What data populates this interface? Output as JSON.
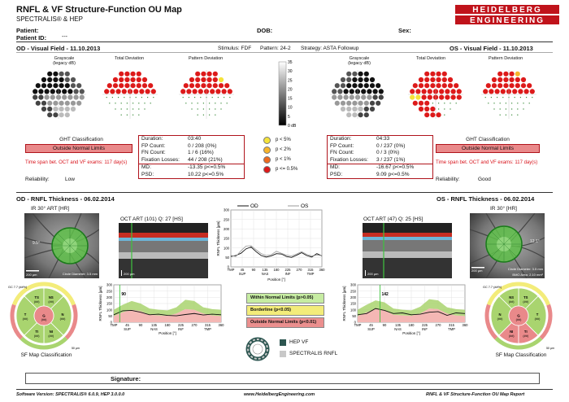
{
  "header": {
    "title": "RNFL & VF Structure-Function OU Map",
    "subtitle": "SPECTRALIS® & HEP",
    "logo_line1": "HEIDELBERG",
    "logo_line2": "ENGINEERING",
    "patient_label": "Patient:",
    "patient_id_label": "Patient ID:",
    "patient_id_value": "---",
    "dob_label": "DOB:",
    "sex_label": "Sex:"
  },
  "vf": {
    "od_title": "OD - Visual Field - 11.10.2013",
    "os_title": "OS - Visual Field - 11.10.2013",
    "stimulus": "Stimulus: FDF",
    "pattern": "Pattern: 24-2",
    "strategy": "Strategy: ASTA Followup",
    "map_labels": [
      "Grayscale",
      "(legacy dB)",
      "Total Deviation",
      "Pattern Deviation"
    ],
    "scale_ticks": [
      "35",
      "30",
      "25",
      "20",
      "15",
      "10",
      "5",
      "0 dB"
    ],
    "legend": [
      {
        "label": "p < 5%",
        "color": "#f5e33a"
      },
      {
        "label": "p < 2%",
        "color": "#f7b52a"
      },
      {
        "label": "p < 1%",
        "color": "#ee6a1e"
      },
      {
        "label": "p <= 0.5%",
        "color": "#dd1a1a"
      }
    ],
    "od": {
      "ght_label": "GHT Classification",
      "ght_value": "Outside Normal Limits",
      "timespan": "Time span bet. OCT and VF exams: 117 day(s)",
      "reliability_label": "Reliability:",
      "reliability_value": "Low",
      "rows": [
        [
          "Duration:",
          "03:40"
        ],
        [
          "FP Count:",
          "0 / 208  (0%)"
        ],
        [
          "FN Count:",
          "1 / 6  (16%)"
        ],
        [
          "Fixation Losses:",
          "44 / 208  (21%)"
        ]
      ],
      "md": [
        "MD:",
        "-13.35 p<=0.5%"
      ],
      "psd": [
        "PSD:",
        "10.22 p<=0.5%"
      ]
    },
    "os": {
      "ght_label": "GHT Classification",
      "ght_value": "Outside Normal Limits",
      "timespan": "Time span bet. OCT and VF exams: 117 day(s)",
      "reliability_label": "Reliability:",
      "reliability_value": "Good",
      "rows": [
        [
          "Duration:",
          "04:33"
        ],
        [
          "FP Count:",
          "0 / 237  (0%)"
        ],
        [
          "FN Count:",
          "0 / 3  (0%)"
        ],
        [
          "Fixation Losses:",
          "3 / 237  (1%)"
        ]
      ],
      "md": [
        "MD:",
        "-16.67 p<=0.5%"
      ],
      "psd": [
        "PSD:",
        "9.09 p<=0.5%"
      ]
    }
  },
  "rnfl": {
    "od_title": "OD - RNFL Thickness - 06.02.2014",
    "os_title": "OS - RNFL Thickness - 06.02.2014",
    "od_ir": "IR 30° ART [HR]",
    "os_ir": "IR 30° [HR]",
    "od_oct": "OCT ART (101) Q: 27 [HS]",
    "os_oct": "OCT ART (47) Q: 25 [HS]",
    "scale_bar": "200 µm",
    "od_circle_info": "Circle Diameter: 3.5 mm",
    "os_circle_info": "Circle Diameter: 3.5 mm",
    "os_bmo_info": "BMO Area: 2.10 mm²",
    "od_fundus_num": "9.5°",
    "os_fundus_num": "12.1°",
    "sf_label": "SF Map Classification",
    "scale_50": "50 µm",
    "limits": {
      "within": "Within Normal Limits (p>0.05)",
      "borderline": "Borderline (p<0.05)",
      "outside": "Outside Normal Limits (p<0.01)"
    },
    "hep_vf": "HEP VF",
    "spectralis_rnfl": "SPECTRALIS RNFL",
    "signature_label": "Signature:"
  },
  "wheel_od": {
    "gc_label": "GC 7.7 (##%)",
    "segments": [
      {
        "name": "TS",
        "value": "",
        "pct": "(##)",
        "color": "#a9d46f"
      },
      {
        "name": "TI",
        "value": "",
        "pct": "(##)",
        "color": "#a9d46f"
      },
      {
        "name": "NS",
        "value": "",
        "pct": "(##)",
        "color": "#a9d46f"
      },
      {
        "name": "NI",
        "value": "",
        "pct": "(##)",
        "color": "#a9d46f"
      },
      {
        "name": "T",
        "value": "",
        "pct": "(##)",
        "color": "#a9d46f"
      },
      {
        "name": "N",
        "value": "",
        "pct": "(##)",
        "color": "#a9d46f"
      },
      {
        "name": "G",
        "value": "",
        "pct": "(##)",
        "color": "#e9898a"
      }
    ]
  },
  "wheel_os": {
    "gc_label": "GC 7.7 (##%)",
    "segments": [
      {
        "name": "TS",
        "value": "",
        "pct": "(##)",
        "color": "#a9d46f"
      },
      {
        "name": "TI",
        "value": "",
        "pct": "(##)",
        "color": "#e9898a"
      },
      {
        "name": "NS",
        "value": "",
        "pct": "(##)",
        "color": "#a9d46f"
      },
      {
        "name": "NI",
        "value": "",
        "pct": "(##)",
        "color": "#e9898a"
      },
      {
        "name": "T",
        "value": "",
        "pct": "(##)",
        "color": "#a9d46f"
      },
      {
        "name": "N",
        "value": "",
        "pct": "(##)",
        "color": "#a9d46f"
      },
      {
        "name": "G",
        "value": "",
        "pct": "(##)",
        "color": "#e9898a"
      }
    ]
  },
  "chart_data": [
    {
      "type": "line",
      "title": "",
      "legend": [
        "OD",
        "OS"
      ],
      "ylabel": "RNFL Thickness [µm]",
      "xlabel": "Position [°]",
      "x_ticks": [
        "TMP",
        "45",
        "90",
        "135",
        "180",
        "225",
        "270",
        "315",
        "360"
      ],
      "x_tick_labels_2": [
        "",
        "SUP",
        "",
        "NAS",
        "",
        "INF",
        "",
        "TMP",
        ""
      ],
      "y_ticks": [
        0,
        50,
        100,
        150,
        200,
        250,
        300
      ],
      "ylim": [
        0,
        300
      ],
      "xlim": [
        0,
        360
      ],
      "x": [
        0,
        20,
        40,
        60,
        80,
        100,
        120,
        140,
        160,
        180,
        200,
        220,
        240,
        260,
        280,
        300,
        320,
        340,
        360
      ],
      "series": [
        {
          "name": "OD",
          "color": "#111111",
          "values": [
            55,
            60,
            72,
            95,
            105,
            80,
            60,
            52,
            58,
            70,
            68,
            55,
            50,
            62,
            75,
            60,
            52,
            70,
            58
          ]
        },
        {
          "name": "OS",
          "color": "#999999",
          "values": [
            60,
            55,
            85,
            110,
            112,
            90,
            70,
            60,
            65,
            82,
            72,
            62,
            58,
            68,
            80,
            66,
            58,
            62,
            60
          ]
        }
      ]
    },
    {
      "type": "area",
      "title": "",
      "ylabel": "RNFL Thickness [µm]",
      "xlabel": "Position [°]",
      "eye": "OD",
      "x_ticks": [
        "TMP",
        "45",
        "90",
        "135",
        "180",
        "225",
        "270",
        "315",
        "360"
      ],
      "x_tick_labels_2": [
        "",
        "SUP",
        "",
        "NAS",
        "",
        "INF",
        "",
        "TMP",
        ""
      ],
      "y_ticks": [
        0,
        50,
        100,
        150,
        200,
        250,
        300
      ],
      "ylim": [
        0,
        300
      ],
      "xlim": [
        0,
        360
      ],
      "marker_label": "90",
      "marker_x": 20,
      "x": [
        0,
        30,
        60,
        90,
        120,
        150,
        180,
        210,
        240,
        270,
        300,
        330,
        360
      ],
      "measured": [
        60,
        92,
        95,
        80,
        60,
        65,
        55,
        52,
        62,
        70,
        58,
        65,
        60
      ],
      "normal_upper": [
        100,
        140,
        170,
        150,
        110,
        100,
        95,
        120,
        180,
        170,
        120,
        105,
        100
      ],
      "normal_lower": [
        50,
        80,
        100,
        90,
        60,
        55,
        52,
        70,
        105,
        100,
        70,
        55,
        50
      ]
    },
    {
      "type": "area",
      "title": "",
      "ylabel": "RNFL Thickness [µm]",
      "xlabel": "Position [°]",
      "eye": "OS",
      "x_ticks": [
        "TMP",
        "45",
        "90",
        "135",
        "180",
        "225",
        "270",
        "315",
        "360"
      ],
      "x_tick_labels_2": [
        "",
        "SUP",
        "",
        "NAS",
        "",
        "INF",
        "",
        "TMP",
        ""
      ],
      "y_ticks": [
        0,
        50,
        100,
        150,
        200,
        250,
        300
      ],
      "ylim": [
        0,
        300
      ],
      "xlim": [
        0,
        360
      ],
      "marker_label": "142",
      "marker_x": 75,
      "x": [
        0,
        30,
        60,
        90,
        120,
        150,
        180,
        210,
        240,
        270,
        300,
        330,
        360
      ],
      "measured": [
        60,
        70,
        110,
        95,
        70,
        75,
        60,
        65,
        80,
        85,
        55,
        75,
        70
      ],
      "normal_upper": [
        100,
        140,
        175,
        160,
        110,
        100,
        95,
        125,
        185,
        175,
        120,
        105,
        100
      ],
      "normal_lower": [
        50,
        80,
        105,
        95,
        60,
        55,
        52,
        70,
        110,
        105,
        70,
        55,
        50
      ]
    }
  ],
  "footer": {
    "software": "Software Version: SPECTRALIS® 6.0.9, HEP 3.0.0.0",
    "url": "www.HeidelbergEngineering.com",
    "report": "RNFL & VF Structure-Function OU Map Report"
  }
}
